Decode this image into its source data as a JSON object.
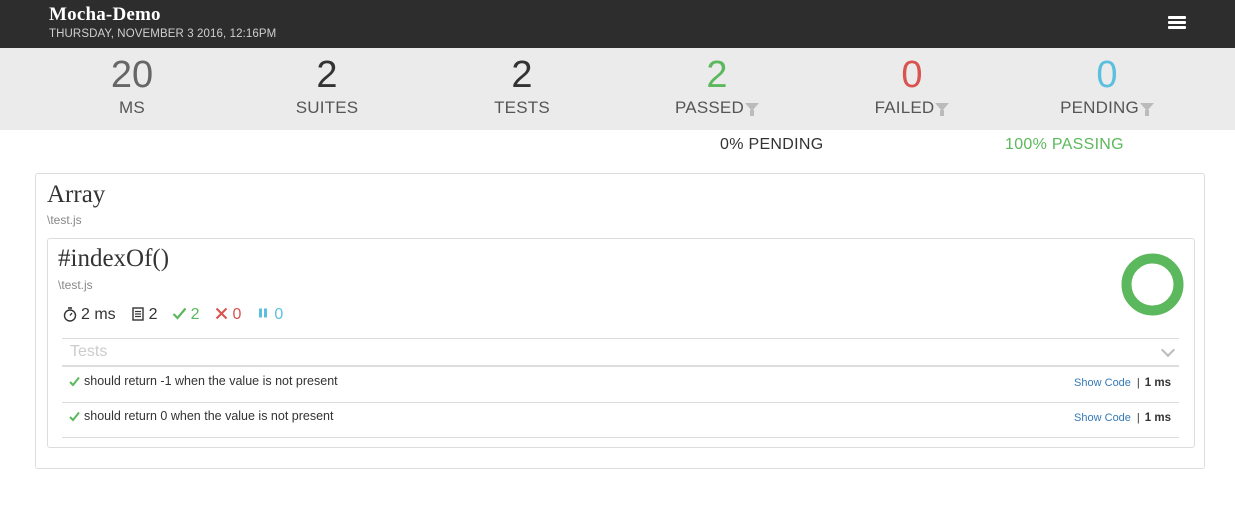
{
  "header": {
    "title": "Mocha-Demo",
    "date": "THURSDAY, NOVEMBER 3 2016, 12:16PM"
  },
  "stats": {
    "duration": {
      "value": "20",
      "label": "MS"
    },
    "suites": {
      "value": "2",
      "label": "SUITES"
    },
    "tests": {
      "value": "2",
      "label": "TESTS"
    },
    "passed": {
      "value": "2",
      "label": "PASSED",
      "color": "#5cb85c"
    },
    "failed": {
      "value": "0",
      "label": "FAILED",
      "color": "#d9534f"
    },
    "pending": {
      "value": "0",
      "label": "PENDING",
      "color": "#5bc0de"
    }
  },
  "summary": {
    "pending_pct": "0% PENDING",
    "passing_pct": "100% PASSING",
    "passing_color": "#5cb85c"
  },
  "suite": {
    "title": "Array",
    "file": "\\test.js",
    "child": {
      "title": "#indexOf()",
      "file": "\\test.js",
      "duration": "2 ms",
      "tests": "2",
      "passed": "2",
      "failed": "0",
      "pending": "0",
      "pass_fraction": 1.0,
      "tests_label": "Tests",
      "rows": [
        {
          "name": "should return -1 when the value is not present",
          "action": "Show Code",
          "sep": "|",
          "duration": "1 ms"
        },
        {
          "name": "should return 0 when the value is not present",
          "action": "Show Code",
          "sep": "|",
          "duration": "1 ms"
        }
      ]
    }
  },
  "icons": {
    "menu": "hamburger-icon",
    "filter": "filter-icon",
    "timer": "stopwatch-icon",
    "tests": "document-icon",
    "passed": "check-icon",
    "failed": "x-icon",
    "pending": "pause-icon",
    "chevron": "chevron-down-icon"
  }
}
